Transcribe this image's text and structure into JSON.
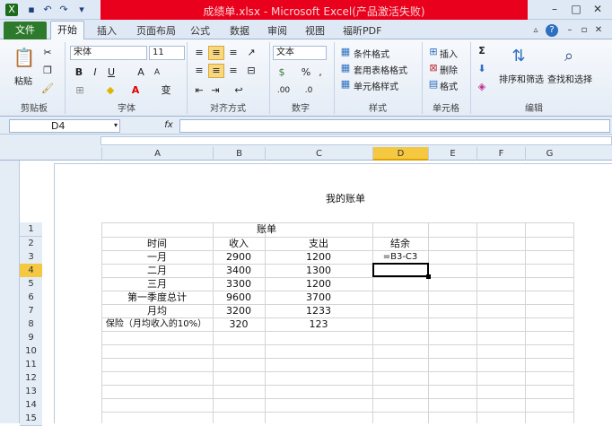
{
  "window": {
    "title": "成绩单.xlsx - Microsoft Excel(产品激活失败)"
  },
  "colors": {
    "titlebar_red": "#e8001d",
    "file_tab_green": "#2d7a2d",
    "selected_col": "#f5c842"
  },
  "tabs": {
    "file": "文件",
    "items": [
      {
        "label": "开始"
      },
      {
        "label": "插入"
      },
      {
        "label": "页面布局"
      },
      {
        "label": "公式"
      },
      {
        "label": "数据"
      },
      {
        "label": "审阅"
      },
      {
        "label": "视图"
      },
      {
        "label": "福昕PDF"
      }
    ]
  },
  "ribbon": {
    "clipboard": {
      "paste": "粘贴",
      "group": "剪贴板"
    },
    "font": {
      "name": "宋体",
      "size": "11",
      "bold": "B",
      "italic": "I",
      "underline": "U",
      "group": "字体"
    },
    "alignment": {
      "group": "对齐方式"
    },
    "number": {
      "format": "文本",
      "percent": "%",
      "group": "数字"
    },
    "styles": {
      "conditional": "条件格式",
      "table": "套用表格格式",
      "cell": "单元格样式",
      "group": "样式"
    },
    "cells": {
      "insert": "插入",
      "delete": "删除",
      "format": "格式",
      "group": "单元格"
    },
    "editing": {
      "sort": "排序和筛选",
      "find": "查找和选择",
      "sum": "Σ",
      "group": "编辑"
    }
  },
  "formula_bar": {
    "name_box": "D4",
    "fx": "fx",
    "formula": ""
  },
  "columns": [
    "A",
    "B",
    "C",
    "D",
    "E",
    "F",
    "G"
  ],
  "rows": [
    "1",
    "2",
    "3",
    "4",
    "5",
    "6",
    "7",
    "8",
    "9",
    "10",
    "11",
    "12",
    "13",
    "14",
    "15"
  ],
  "sheet": {
    "header_text": "我的账单",
    "title": "账单",
    "table": [
      {
        "a": "时间",
        "b": "收入",
        "c": "支出",
        "d": "结余"
      },
      {
        "a": "一月",
        "b": "2900",
        "c": "1200",
        "d": "=B3-C3"
      },
      {
        "a": "二月",
        "b": "3400",
        "c": "1300",
        "d": ""
      },
      {
        "a": "三月",
        "b": "3300",
        "c": "1200",
        "d": ""
      },
      {
        "a": "第一季度总计",
        "b": "9600",
        "c": "3700",
        "d": ""
      },
      {
        "a": "月均",
        "b": "3200",
        "c": "1233",
        "d": ""
      },
      {
        "a": "保险（月均收入的10%）",
        "b": "320",
        "c": "123",
        "d": ""
      }
    ]
  }
}
